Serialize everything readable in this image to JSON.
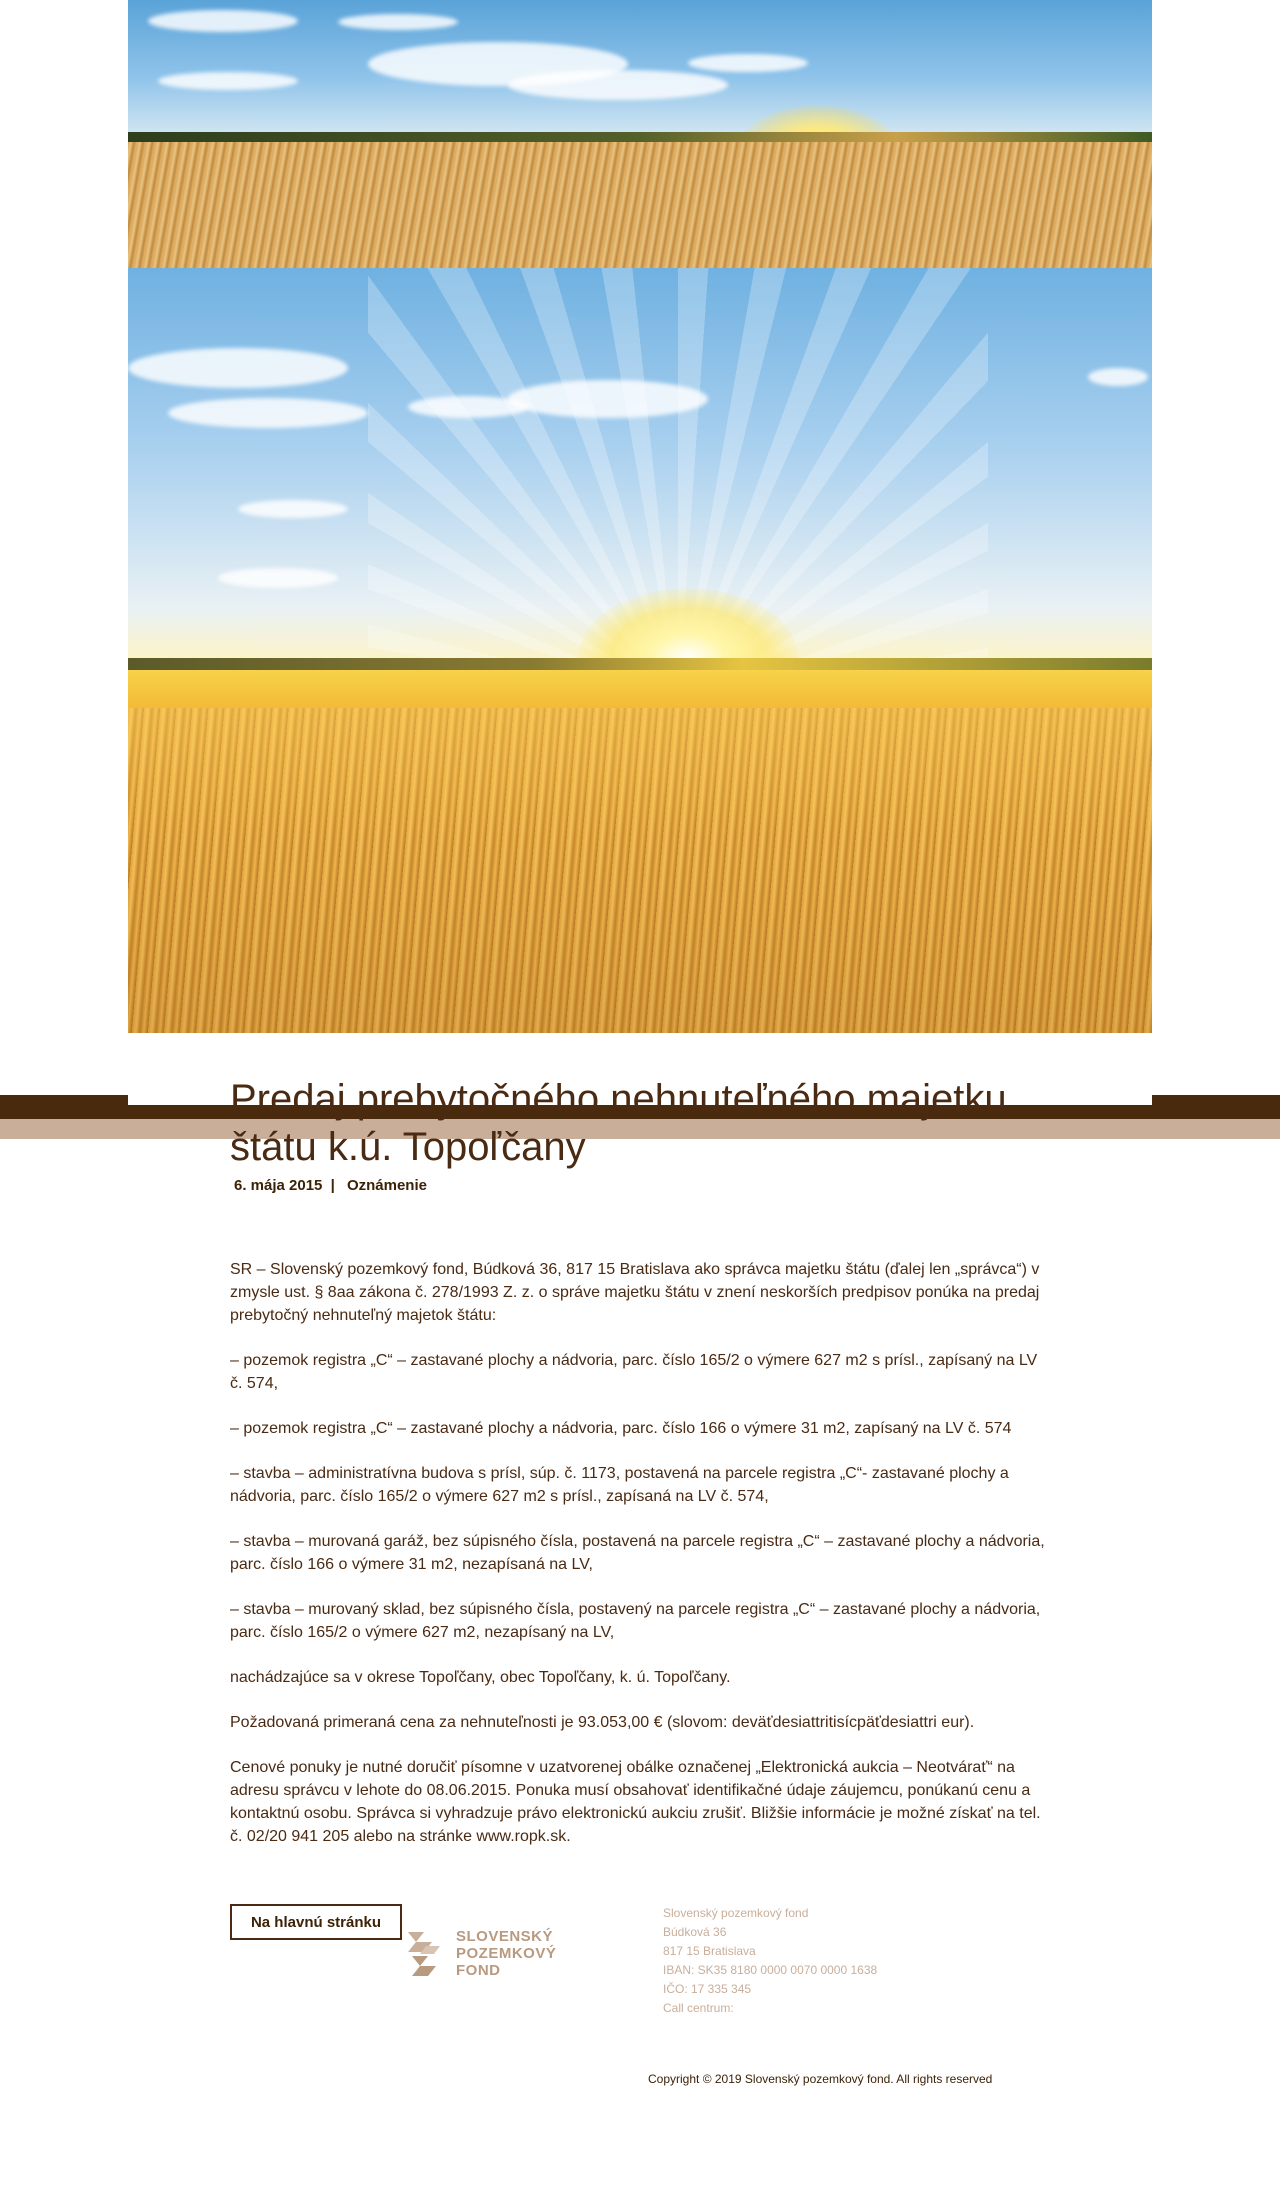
{
  "article": {
    "title": "Predaj prebytočného nehnuteľného majetku štátu k.ú. Topoľčany",
    "date": "6. mája 2015",
    "separator": "|",
    "category": "Oznámenie",
    "paragraphs": [
      "SR – Slovenský pozemkový fond, Búdková 36, 817 15 Bratislava ako správca majetku štátu (ďalej len „správca“) v zmysle ust. § 8aa zákona č. 278/1993 Z. z. o správe majetku štátu v znení neskorších predpisov ponúka na predaj prebytočný nehnuteľný majetok štátu:",
      "– pozemok registra „C“ – zastavané plochy a nádvoria, parc. číslo 165/2 o výmere 627 m2 s prísl., zapísaný na LV č. 574,",
      "– pozemok registra „C“ – zastavané plochy a nádvoria, parc. číslo 166 o výmere 31 m2, zapísaný na LV č. 574",
      "– stavba – administratívna budova s prísl, súp. č. 1173, postavená na parcele registra „C“- zastavané plochy a nádvoria, parc. číslo 165/2 o výmere 627 m2 s prísl., zapísaná na LV č. 574,",
      "– stavba – murovaná garáž, bez súpisného čísla, postavená na parcele registra „C“ – zastavané plochy a nádvoria, parc. číslo 166 o výmere 31 m2, nezapísaná na LV,",
      "– stavba – murovaný sklad, bez súpisného čísla, postavený na parcele registra „C“ – zastavané plochy a nádvoria, parc. číslo 165/2 o výmere 627 m2, nezapísaný na LV,",
      "nachádzajúce sa v okrese Topoľčany, obec Topoľčany, k. ú. Topoľčany.",
      "Požadovaná primeraná cena za nehnuteľnosti je 93.053,00 € (slovom: deväťdesiattritisícpäťdesiattri eur).",
      "Cenové ponuky je nutné doručiť písomne v uzatvorenej obálke označenej „Elektronická aukcia – Neotvárať“ na adresu správcu v lehote do 08.06.2015. Ponuka musí obsahovať identifikačné údaje záujemcu, ponúkanú cenu a kontaktnú osobu. Správca si vyhradzuje právo elektronickú aukciu zrušiť. Bližšie informácie je možné získať na tel. č. 02/20 941 205 alebo na stránke www.ropk.sk."
    ]
  },
  "footer": {
    "home_button": "Na hlavnú stránku",
    "logo_lines": [
      "SLOVENSKÝ",
      "POZEMKOVÝ",
      "FOND"
    ],
    "info_lines": [
      "Slovenský pozemkový fond",
      "Búdková 36",
      "817 15 Bratislava",
      "IBAN: SK35 8180 0000 0070 0000 1638",
      "IČO: 17 335 345",
      "Call centrum:"
    ],
    "copyright": "Copyright © 2019 Slovenský pozemkový fond. All rights reserved"
  },
  "colors": {
    "brand_brown": "#4a2a0c",
    "brand_beige": "#c9ae9a",
    "text_brown": "#4a2a12"
  }
}
